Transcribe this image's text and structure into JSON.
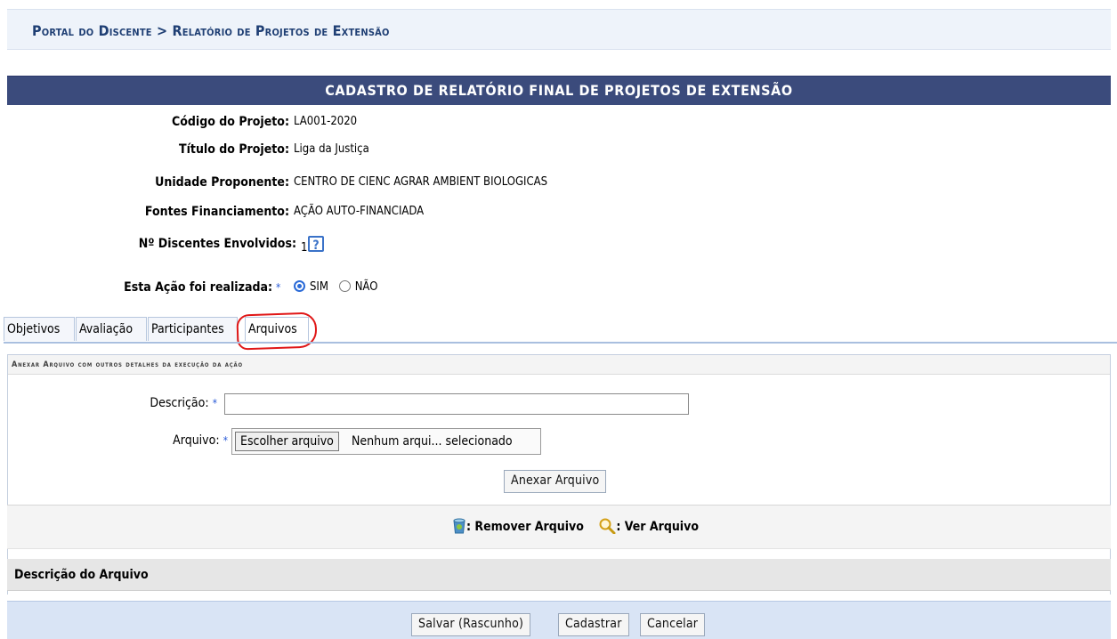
{
  "breadcrumb": "Portal do Discente > Relatório de Projetos de Extensão",
  "form_title": "CADASTRO DE RELATÓRIO FINAL DE PROJETOS DE EXTENSÃO",
  "info": {
    "codigo_label": "Código do Projeto:",
    "codigo_value": "LA001-2020",
    "titulo_label": "Título do Projeto:",
    "titulo_value": "Liga da Justiça",
    "unidade_label": "Unidade Proponente:",
    "unidade_value": "CENTRO DE CIENC AGRAR AMBIENT BIOLOGICAS",
    "fontes_label": "Fontes Financiamento:",
    "fontes_value": "AÇÃO AUTO-FINANCIADA",
    "discentes_label": "Nº Discentes Envolvidos:",
    "discentes_value": "1",
    "help_symbol": "?"
  },
  "realizada": {
    "label": "Esta Ação foi realizada:",
    "required_mark": "*",
    "options": [
      "SIM",
      "NÃO"
    ],
    "selected": "SIM"
  },
  "tabs": [
    "Objetivos",
    "Avaliação",
    "Participantes",
    "Arquivos"
  ],
  "active_tab": "Arquivos",
  "attach_section": {
    "caption": "Anexar Arquivo com outros detalhes da execução da ação",
    "descricao_label": "Descrição:",
    "descricao_value": "",
    "arquivo_label": "Arquivo:",
    "required_mark": "*",
    "choose_file_button": "Escolher arquivo",
    "file_status": "Nenhum arqui... selecionado",
    "attach_button": "Anexar Arquivo"
  },
  "legend": {
    "remove_label": ": Remover Arquivo",
    "view_label": ": Ver Arquivo",
    "remove_icon": "trash-icon",
    "view_icon": "magnifier-icon"
  },
  "table": {
    "header": "Descrição do Arquivo"
  },
  "footer_buttons": {
    "save_draft": "Salvar (Rascunho)",
    "register": "Cadastrar",
    "cancel": "Cancelar"
  },
  "colors": {
    "title_bar": "#3b4b7c",
    "breadcrumb_text": "#1f3f74",
    "annotation_red": "#e01717",
    "footer_band": "#d9e4f5"
  }
}
